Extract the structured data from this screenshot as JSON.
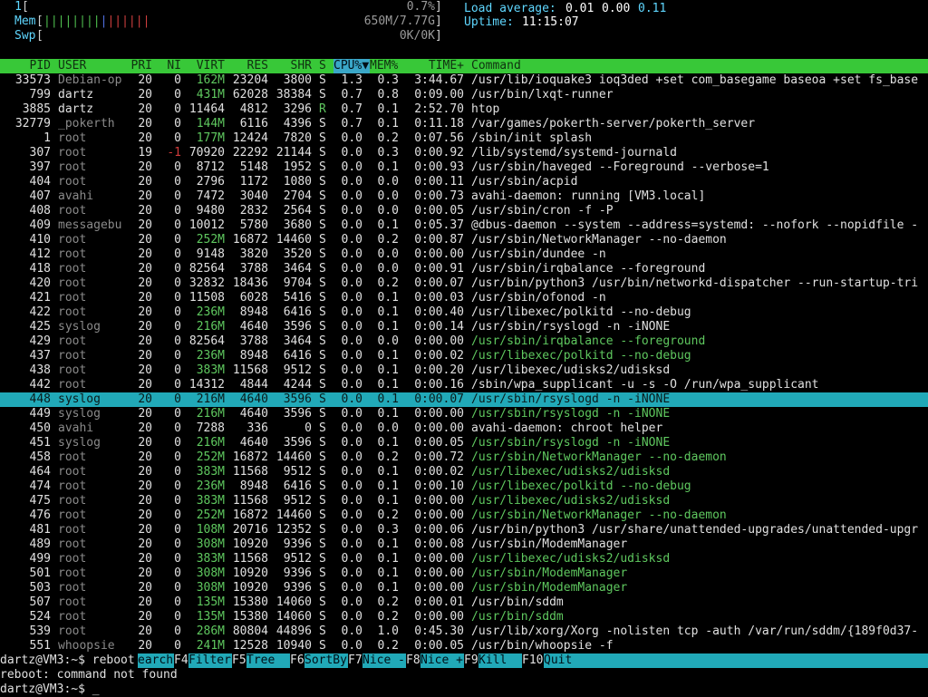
{
  "meters": {
    "cpu": {
      "label": "1",
      "value": "0.7%"
    },
    "mem": {
      "label": "Mem",
      "value": "650M/7.77G"
    },
    "swp": {
      "label": "Swp",
      "value": "0K/0K"
    },
    "load_label": "Load average:",
    "load_1": "0.01",
    "load_5": "0.00",
    "load_15": "0.11",
    "uptime_label": "Uptime:",
    "uptime_value": "11:15:07"
  },
  "columns": [
    "PID",
    "USER",
    "PRI",
    "NI",
    "VIRT",
    "RES",
    "SHR",
    "S",
    "CPU%",
    "MEM%",
    "TIME+",
    "Command"
  ],
  "sort_marker": "▼",
  "rows": [
    {
      "pid": "33573",
      "user": "Debian-op",
      "pri": "20",
      "ni": "0",
      "virt": "162M",
      "res": "23204",
      "shr": "3800",
      "s": "S",
      "cpu": "1.3",
      "mem": "0.3",
      "time": "3:44.67",
      "cmd": "/usr/lib/ioquake3 ioq3ded +set com_basegame baseoa +set fs_base",
      "thread": false
    },
    {
      "pid": "799",
      "user": "dartz",
      "pri": "20",
      "ni": "0",
      "virt": "431M",
      "res": "62028",
      "shr": "38384",
      "s": "S",
      "cpu": "0.7",
      "mem": "0.8",
      "time": "0:09.00",
      "cmd": "/usr/bin/lxqt-runner",
      "thread": false
    },
    {
      "pid": "3885",
      "user": "dartz",
      "pri": "20",
      "ni": "0",
      "virt": "11464",
      "res": "4812",
      "shr": "3296",
      "s": "R",
      "cpu": "0.7",
      "mem": "0.1",
      "time": "2:52.70",
      "cmd": "htop",
      "thread": false
    },
    {
      "pid": "32779",
      "user": "_pokerth",
      "pri": "20",
      "ni": "0",
      "virt": "144M",
      "res": "6116",
      "shr": "4396",
      "s": "S",
      "cpu": "0.7",
      "mem": "0.1",
      "time": "0:11.18",
      "cmd": "/var/games/pokerth-server/pokerth_server",
      "thread": false
    },
    {
      "pid": "1",
      "user": "root",
      "pri": "20",
      "ni": "0",
      "virt": "177M",
      "res": "12424",
      "shr": "7820",
      "s": "S",
      "cpu": "0.0",
      "mem": "0.2",
      "time": "0:07.56",
      "cmd": "/sbin/init splash",
      "thread": false
    },
    {
      "pid": "307",
      "user": "root",
      "pri": "19",
      "ni": "-1",
      "virt": "70920",
      "res": "22292",
      "shr": "21144",
      "s": "S",
      "cpu": "0.0",
      "mem": "0.3",
      "time": "0:00.92",
      "cmd": "/lib/systemd/systemd-journald",
      "thread": false
    },
    {
      "pid": "397",
      "user": "root",
      "pri": "20",
      "ni": "0",
      "virt": "8712",
      "res": "5148",
      "shr": "1952",
      "s": "S",
      "cpu": "0.0",
      "mem": "0.1",
      "time": "0:00.93",
      "cmd": "/usr/sbin/haveged --Foreground --verbose=1",
      "thread": false
    },
    {
      "pid": "404",
      "user": "root",
      "pri": "20",
      "ni": "0",
      "virt": "2796",
      "res": "1172",
      "shr": "1080",
      "s": "S",
      "cpu": "0.0",
      "mem": "0.0",
      "time": "0:00.11",
      "cmd": "/usr/sbin/acpid",
      "thread": false
    },
    {
      "pid": "407",
      "user": "avahi",
      "pri": "20",
      "ni": "0",
      "virt": "7472",
      "res": "3040",
      "shr": "2704",
      "s": "S",
      "cpu": "0.0",
      "mem": "0.0",
      "time": "0:00.73",
      "cmd": "avahi-daemon: running [VM3.local]",
      "thread": false
    },
    {
      "pid": "408",
      "user": "root",
      "pri": "20",
      "ni": "0",
      "virt": "9480",
      "res": "2832",
      "shr": "2564",
      "s": "S",
      "cpu": "0.0",
      "mem": "0.0",
      "time": "0:00.05",
      "cmd": "/usr/sbin/cron -f -P",
      "thread": false
    },
    {
      "pid": "409",
      "user": "messagebu",
      "pri": "20",
      "ni": "0",
      "virt": "10012",
      "res": "5780",
      "shr": "3680",
      "s": "S",
      "cpu": "0.0",
      "mem": "0.1",
      "time": "0:05.37",
      "cmd": "@dbus-daemon --system --address=systemd: --nofork --nopidfile -",
      "thread": false
    },
    {
      "pid": "410",
      "user": "root",
      "pri": "20",
      "ni": "0",
      "virt": "252M",
      "res": "16872",
      "shr": "14460",
      "s": "S",
      "cpu": "0.0",
      "mem": "0.2",
      "time": "0:00.87",
      "cmd": "/usr/sbin/NetworkManager --no-daemon",
      "thread": false
    },
    {
      "pid": "412",
      "user": "root",
      "pri": "20",
      "ni": "0",
      "virt": "9148",
      "res": "3820",
      "shr": "3520",
      "s": "S",
      "cpu": "0.0",
      "mem": "0.0",
      "time": "0:00.00",
      "cmd": "/usr/sbin/dundee -n",
      "thread": false
    },
    {
      "pid": "418",
      "user": "root",
      "pri": "20",
      "ni": "0",
      "virt": "82564",
      "res": "3788",
      "shr": "3464",
      "s": "S",
      "cpu": "0.0",
      "mem": "0.0",
      "time": "0:00.91",
      "cmd": "/usr/sbin/irqbalance --foreground",
      "thread": false
    },
    {
      "pid": "420",
      "user": "root",
      "pri": "20",
      "ni": "0",
      "virt": "32832",
      "res": "18436",
      "shr": "9704",
      "s": "S",
      "cpu": "0.0",
      "mem": "0.2",
      "time": "0:00.07",
      "cmd": "/usr/bin/python3 /usr/bin/networkd-dispatcher --run-startup-tri",
      "thread": false
    },
    {
      "pid": "421",
      "user": "root",
      "pri": "20",
      "ni": "0",
      "virt": "11508",
      "res": "6028",
      "shr": "5416",
      "s": "S",
      "cpu": "0.0",
      "mem": "0.1",
      "time": "0:00.03",
      "cmd": "/usr/sbin/ofonod -n",
      "thread": false
    },
    {
      "pid": "422",
      "user": "root",
      "pri": "20",
      "ni": "0",
      "virt": "236M",
      "res": "8948",
      "shr": "6416",
      "s": "S",
      "cpu": "0.0",
      "mem": "0.1",
      "time": "0:00.40",
      "cmd": "/usr/libexec/polkitd --no-debug",
      "thread": false
    },
    {
      "pid": "425",
      "user": "syslog",
      "pri": "20",
      "ni": "0",
      "virt": "216M",
      "res": "4640",
      "shr": "3596",
      "s": "S",
      "cpu": "0.0",
      "mem": "0.1",
      "time": "0:00.14",
      "cmd": "/usr/sbin/rsyslogd -n -iNONE",
      "thread": false
    },
    {
      "pid": "429",
      "user": "root",
      "pri": "20",
      "ni": "0",
      "virt": "82564",
      "res": "3788",
      "shr": "3464",
      "s": "S",
      "cpu": "0.0",
      "mem": "0.0",
      "time": "0:00.00",
      "cmd": "/usr/sbin/irqbalance --foreground",
      "thread": true
    },
    {
      "pid": "437",
      "user": "root",
      "pri": "20",
      "ni": "0",
      "virt": "236M",
      "res": "8948",
      "shr": "6416",
      "s": "S",
      "cpu": "0.0",
      "mem": "0.1",
      "time": "0:00.02",
      "cmd": "/usr/libexec/polkitd --no-debug",
      "thread": true
    },
    {
      "pid": "438",
      "user": "root",
      "pri": "20",
      "ni": "0",
      "virt": "383M",
      "res": "11568",
      "shr": "9512",
      "s": "S",
      "cpu": "0.0",
      "mem": "0.1",
      "time": "0:00.20",
      "cmd": "/usr/libexec/udisks2/udisksd",
      "thread": false
    },
    {
      "pid": "442",
      "user": "root",
      "pri": "20",
      "ni": "0",
      "virt": "14312",
      "res": "4844",
      "shr": "4244",
      "s": "S",
      "cpu": "0.0",
      "mem": "0.1",
      "time": "0:00.16",
      "cmd": "/sbin/wpa_supplicant -u -s -O /run/wpa_supplicant",
      "thread": false
    },
    {
      "pid": "448",
      "user": "syslog",
      "pri": "20",
      "ni": "0",
      "virt": "216M",
      "res": "4640",
      "shr": "3596",
      "s": "S",
      "cpu": "0.0",
      "mem": "0.1",
      "time": "0:00.07",
      "cmd": "/usr/sbin/rsyslogd -n -iNONE",
      "thread": true,
      "selected": true
    },
    {
      "pid": "449",
      "user": "syslog",
      "pri": "20",
      "ni": "0",
      "virt": "216M",
      "res": "4640",
      "shr": "3596",
      "s": "S",
      "cpu": "0.0",
      "mem": "0.1",
      "time": "0:00.00",
      "cmd": "/usr/sbin/rsyslogd -n -iNONE",
      "thread": true
    },
    {
      "pid": "450",
      "user": "avahi",
      "pri": "20",
      "ni": "0",
      "virt": "7288",
      "res": "336",
      "shr": "0",
      "s": "S",
      "cpu": "0.0",
      "mem": "0.0",
      "time": "0:00.00",
      "cmd": "avahi-daemon: chroot helper",
      "thread": false
    },
    {
      "pid": "451",
      "user": "syslog",
      "pri": "20",
      "ni": "0",
      "virt": "216M",
      "res": "4640",
      "shr": "3596",
      "s": "S",
      "cpu": "0.0",
      "mem": "0.1",
      "time": "0:00.05",
      "cmd": "/usr/sbin/rsyslogd -n -iNONE",
      "thread": true
    },
    {
      "pid": "458",
      "user": "root",
      "pri": "20",
      "ni": "0",
      "virt": "252M",
      "res": "16872",
      "shr": "14460",
      "s": "S",
      "cpu": "0.0",
      "mem": "0.2",
      "time": "0:00.72",
      "cmd": "/usr/sbin/NetworkManager --no-daemon",
      "thread": true
    },
    {
      "pid": "464",
      "user": "root",
      "pri": "20",
      "ni": "0",
      "virt": "383M",
      "res": "11568",
      "shr": "9512",
      "s": "S",
      "cpu": "0.0",
      "mem": "0.1",
      "time": "0:00.02",
      "cmd": "/usr/libexec/udisks2/udisksd",
      "thread": true
    },
    {
      "pid": "474",
      "user": "root",
      "pri": "20",
      "ni": "0",
      "virt": "236M",
      "res": "8948",
      "shr": "6416",
      "s": "S",
      "cpu": "0.0",
      "mem": "0.1",
      "time": "0:00.10",
      "cmd": "/usr/libexec/polkitd --no-debug",
      "thread": true
    },
    {
      "pid": "475",
      "user": "root",
      "pri": "20",
      "ni": "0",
      "virt": "383M",
      "res": "11568",
      "shr": "9512",
      "s": "S",
      "cpu": "0.0",
      "mem": "0.1",
      "time": "0:00.00",
      "cmd": "/usr/libexec/udisks2/udisksd",
      "thread": true
    },
    {
      "pid": "476",
      "user": "root",
      "pri": "20",
      "ni": "0",
      "virt": "252M",
      "res": "16872",
      "shr": "14460",
      "s": "S",
      "cpu": "0.0",
      "mem": "0.2",
      "time": "0:00.00",
      "cmd": "/usr/sbin/NetworkManager --no-daemon",
      "thread": true
    },
    {
      "pid": "481",
      "user": "root",
      "pri": "20",
      "ni": "0",
      "virt": "108M",
      "res": "20716",
      "shr": "12352",
      "s": "S",
      "cpu": "0.0",
      "mem": "0.3",
      "time": "0:00.06",
      "cmd": "/usr/bin/python3 /usr/share/unattended-upgrades/unattended-upgr",
      "thread": false
    },
    {
      "pid": "489",
      "user": "root",
      "pri": "20",
      "ni": "0",
      "virt": "308M",
      "res": "10920",
      "shr": "9396",
      "s": "S",
      "cpu": "0.0",
      "mem": "0.1",
      "time": "0:00.08",
      "cmd": "/usr/sbin/ModemManager",
      "thread": false
    },
    {
      "pid": "499",
      "user": "root",
      "pri": "20",
      "ni": "0",
      "virt": "383M",
      "res": "11568",
      "shr": "9512",
      "s": "S",
      "cpu": "0.0",
      "mem": "0.1",
      "time": "0:00.00",
      "cmd": "/usr/libexec/udisks2/udisksd",
      "thread": true
    },
    {
      "pid": "501",
      "user": "root",
      "pri": "20",
      "ni": "0",
      "virt": "308M",
      "res": "10920",
      "shr": "9396",
      "s": "S",
      "cpu": "0.0",
      "mem": "0.1",
      "time": "0:00.00",
      "cmd": "/usr/sbin/ModemManager",
      "thread": true
    },
    {
      "pid": "503",
      "user": "root",
      "pri": "20",
      "ni": "0",
      "virt": "308M",
      "res": "10920",
      "shr": "9396",
      "s": "S",
      "cpu": "0.0",
      "mem": "0.1",
      "time": "0:00.00",
      "cmd": "/usr/sbin/ModemManager",
      "thread": true
    },
    {
      "pid": "507",
      "user": "root",
      "pri": "20",
      "ni": "0",
      "virt": "135M",
      "res": "15380",
      "shr": "14060",
      "s": "S",
      "cpu": "0.0",
      "mem": "0.2",
      "time": "0:00.01",
      "cmd": "/usr/bin/sddm",
      "thread": false
    },
    {
      "pid": "524",
      "user": "root",
      "pri": "20",
      "ni": "0",
      "virt": "135M",
      "res": "15380",
      "shr": "14060",
      "s": "S",
      "cpu": "0.0",
      "mem": "0.2",
      "time": "0:00.00",
      "cmd": "/usr/bin/sddm",
      "thread": true
    },
    {
      "pid": "539",
      "user": "root",
      "pri": "20",
      "ni": "0",
      "virt": "286M",
      "res": "80804",
      "shr": "44896",
      "s": "S",
      "cpu": "0.0",
      "mem": "1.0",
      "time": "0:45.30",
      "cmd": "/usr/lib/xorg/Xorg -nolisten tcp -auth /var/run/sddm/{189f0d37-",
      "thread": false
    },
    {
      "pid": "551",
      "user": "whoopsie",
      "pri": "20",
      "ni": "0",
      "virt": "241M",
      "res": "12528",
      "shr": "10940",
      "s": "S",
      "cpu": "0.0",
      "mem": "0.2",
      "time": "0:00.05",
      "cmd": "/usr/bin/whoopsie -f",
      "thread": false
    }
  ],
  "footer": {
    "prompt_line": "dartz@VM3:~$ reboot",
    "keys": [
      {
        "label": "earch"
      },
      {
        "key": "F4",
        "label": "Filter"
      },
      {
        "key": "F5",
        "label": "Tree  "
      },
      {
        "key": "F6",
        "label": "SortBy"
      },
      {
        "key": "F7",
        "label": "Nice -"
      },
      {
        "key": "F8",
        "label": "Nice +"
      },
      {
        "key": "F9",
        "label": "Kill  "
      },
      {
        "key": "F10",
        "label": "Quit"
      }
    ],
    "error_line": "reboot: command not found",
    "prompt2": "dartz@VM3:~$ _"
  },
  "colors": {
    "header_bg": "#38c838",
    "selected_bg": "#21a9b8",
    "thread_cmd": "#5fc85f",
    "neg_nice": "#d03c3c"
  }
}
